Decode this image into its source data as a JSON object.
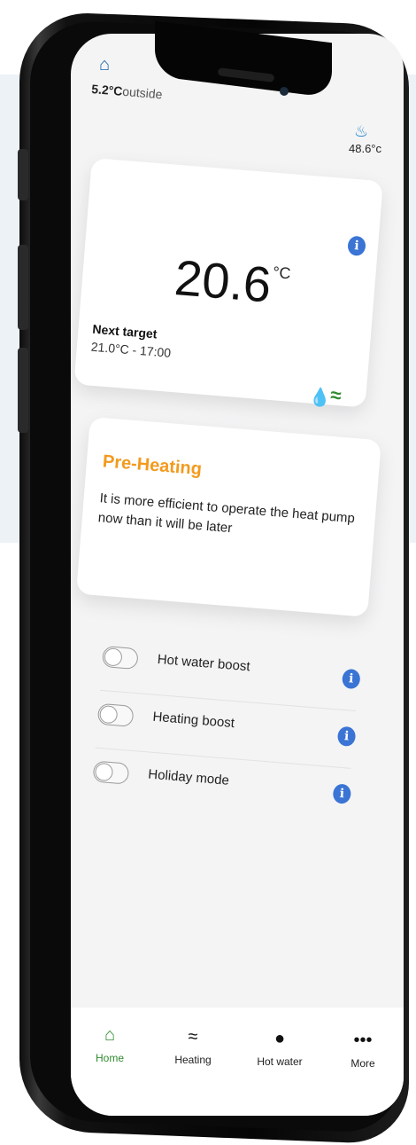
{
  "status": {
    "outside_value": "5.2°C",
    "outside_label": "outside",
    "hot_water_temp": "48.6°c"
  },
  "temperature_card": {
    "current_temp": "20.6",
    "unit": "°C",
    "next_target_label": "Next target",
    "next_target_value": "21.0°C - 17:00",
    "info_icon": "i"
  },
  "preheating_card": {
    "title": "Pre-Heating",
    "text": "It is more efficient to operate the heat pump now than it will be later"
  },
  "toggles": [
    {
      "label": "Hot water boost",
      "on": false
    },
    {
      "label": "Heating boost",
      "on": false
    },
    {
      "label": "Holiday mode",
      "on": false
    }
  ],
  "tabbar": {
    "home": "Home",
    "heating": "Heating",
    "hot_water": "Hot water",
    "more": "More"
  },
  "colors": {
    "accent_green": "#2e8b2e",
    "preheat_orange": "#f39a1e",
    "info_blue": "#3a74d4",
    "home_blue": "#1a62a8"
  },
  "icons": {
    "home": "home-icon",
    "tap": "tap-icon",
    "info": "info-icon",
    "drop": "water-drop-icon",
    "heat": "heat-waves-icon",
    "more": "more-dots-icon"
  }
}
